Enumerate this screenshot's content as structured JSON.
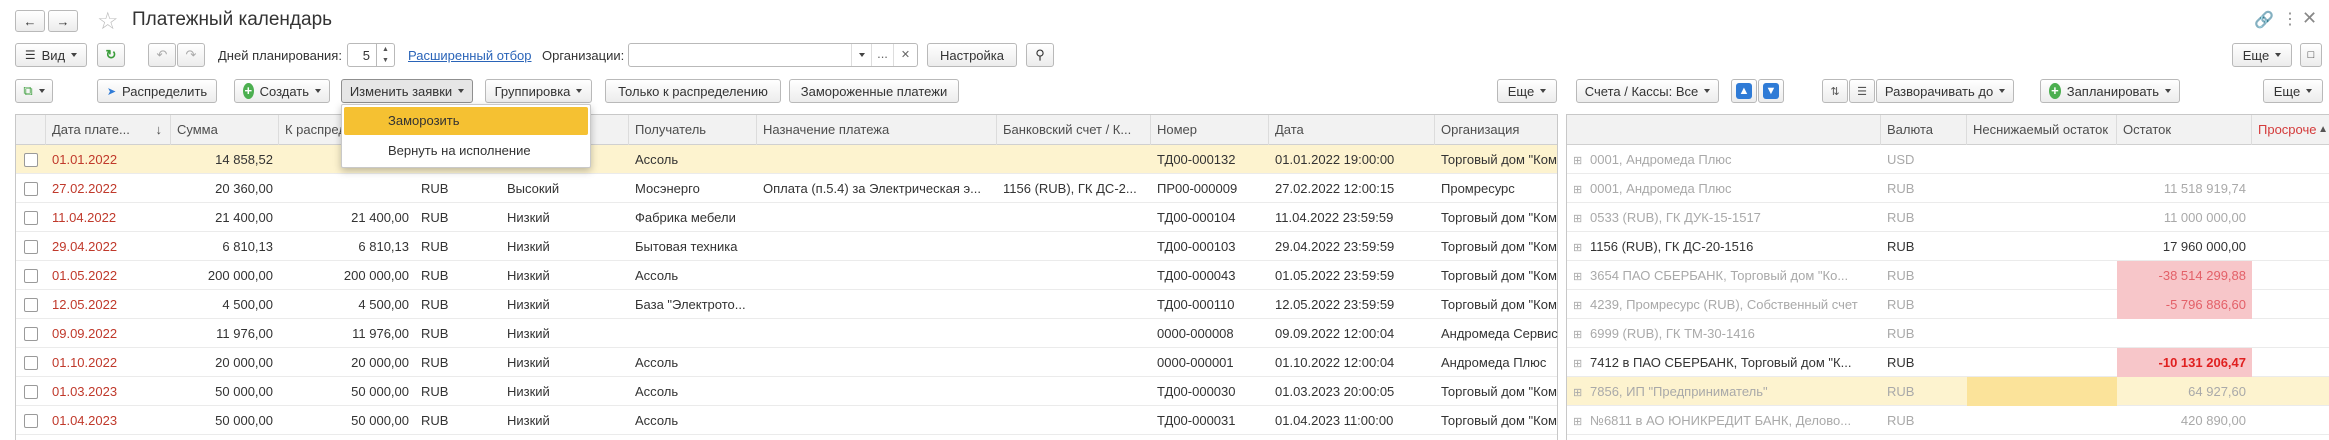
{
  "title": "Платежный календарь",
  "toolbar1": {
    "view": "Вид",
    "days_label": "Дней планирования:",
    "days_value": "5",
    "ext_filter": "Расширенный отбор",
    "orgs_label": "Организации:",
    "orgs_value": "",
    "settings": "Настройка",
    "more": "Еще"
  },
  "toolbar2": {
    "distribute": "Распределить",
    "create": "Создать",
    "change_requests": "Изменить заявки",
    "grouping": "Группировка",
    "only_to_distribute": "Только к распределению",
    "frozen": "Замороженные платежи",
    "more_left": "Еще",
    "accounts": "Счета / Кассы: Все",
    "expand_to": "Разворачивать до",
    "plan": "Запланировать",
    "more_right": "Еще"
  },
  "dropdown": {
    "items": [
      "Заморозить",
      "Вернуть на исполнение"
    ]
  },
  "left_table": {
    "columns": [
      "Дата плате...",
      "Сумма",
      "К распред",
      "",
      "",
      "Получатель",
      "Назначение платежа",
      "Банковский счет / К...",
      "Номер",
      "Дата",
      "Организация"
    ],
    "rows": [
      {
        "date": "01.01.2022",
        "sum": "14 858,52",
        "dist": "",
        "cur": "",
        "prio": "",
        "payee": "Ассоль",
        "purpose": "",
        "account": "",
        "num": "ТД00-000132",
        "dt": "01.01.2022 19:00:00",
        "org": "Торговый дом \"Ком"
      },
      {
        "date": "27.02.2022",
        "sum": "20 360,00",
        "dist": "",
        "cur": "RUB",
        "prio": "Высокий",
        "payee": "Мосэнерго",
        "purpose": "Оплата (п.5.4) за Электрическая э...",
        "account": "1156 (RUB), ГК ДС-2...",
        "num": "ПР00-000009",
        "dt": "27.02.2022 12:00:15",
        "org": "Промресурс"
      },
      {
        "date": "11.04.2022",
        "sum": "21 400,00",
        "dist": "21 400,00",
        "cur": "RUB",
        "prio": "Низкий",
        "payee": "Фабрика мебели",
        "purpose": "",
        "account": "",
        "num": "ТД00-000104",
        "dt": "11.04.2022 23:59:59",
        "org": "Торговый дом \"Ком"
      },
      {
        "date": "29.04.2022",
        "sum": "6 810,13",
        "dist": "6 810,13",
        "cur": "RUB",
        "prio": "Низкий",
        "payee": "Бытовая техника",
        "purpose": "",
        "account": "",
        "num": "ТД00-000103",
        "dt": "29.04.2022 23:59:59",
        "org": "Торговый дом \"Ком"
      },
      {
        "date": "01.05.2022",
        "sum": "200 000,00",
        "dist": "200 000,00",
        "cur": "RUB",
        "prio": "Низкий",
        "payee": "Ассоль",
        "purpose": "",
        "account": "",
        "num": "ТД00-000043",
        "dt": "01.05.2022 23:59:59",
        "org": "Торговый дом \"Ком"
      },
      {
        "date": "12.05.2022",
        "sum": "4 500,00",
        "dist": "4 500,00",
        "cur": "RUB",
        "prio": "Низкий",
        "payee": "База \"Электрото...",
        "purpose": "",
        "account": "",
        "num": "ТД00-000110",
        "dt": "12.05.2022 23:59:59",
        "org": "Торговый дом \"Ком"
      },
      {
        "date": "09.09.2022",
        "sum": "11 976,00",
        "dist": "11 976,00",
        "cur": "RUB",
        "prio": "Низкий",
        "payee": "",
        "purpose": "",
        "account": "",
        "num": "0000-000008",
        "dt": "09.09.2022 12:00:04",
        "org": "Андромеда Сервис"
      },
      {
        "date": "01.10.2022",
        "sum": "20 000,00",
        "dist": "20 000,00",
        "cur": "RUB",
        "prio": "Низкий",
        "payee": "Ассоль",
        "purpose": "",
        "account": "",
        "num": "0000-000001",
        "dt": "01.10.2022 12:00:04",
        "org": "Андромеда Плюс"
      },
      {
        "date": "01.03.2023",
        "sum": "50 000,00",
        "dist": "50 000,00",
        "cur": "RUB",
        "prio": "Низкий",
        "payee": "Ассоль",
        "purpose": "",
        "account": "",
        "num": "ТД00-000030",
        "dt": "01.03.2023 20:00:05",
        "org": "Торговый дом \"Ком"
      },
      {
        "date": "01.04.2023",
        "sum": "50 000,00",
        "dist": "50 000,00",
        "cur": "RUB",
        "prio": "Низкий",
        "payee": "Ассоль",
        "purpose": "",
        "account": "",
        "num": "ТД00-000031",
        "dt": "01.04.2023 11:00:00",
        "org": "Торговый дом \"Ком"
      }
    ]
  },
  "right_table": {
    "columns": [
      "",
      "Валюта",
      "Неснижаемый остаток",
      "Остаток",
      "Просроче"
    ],
    "rows": [
      {
        "name": "0001, Андромеда Плюс",
        "cur": "USD",
        "min": "",
        "bal": "",
        "state": "gray"
      },
      {
        "name": "0001, Андромеда Плюс",
        "cur": "RUB",
        "min": "",
        "bal": "11 518 919,74",
        "state": "gray"
      },
      {
        "name": "0533 (RUB), ГК ДУК-15-1517",
        "cur": "RUB",
        "min": "",
        "bal": "11 000 000,00",
        "state": "gray"
      },
      {
        "name": "1156 (RUB), ГК ДС-20-1516",
        "cur": "RUB",
        "min": "",
        "bal": "17 960 000,00",
        "state": "normal"
      },
      {
        "name": "3654 ПАО СБЕРБАНК, Торговый дом \"Ко...",
        "cur": "RUB",
        "min": "",
        "bal": "-38 514 299,88",
        "state": "neg"
      },
      {
        "name": "4239, Промресурс (RUB), Собственный счет",
        "cur": "RUB",
        "min": "",
        "bal": "-5 796 886,60",
        "state": "neg"
      },
      {
        "name": "6999 (RUB), ГК ТМ-30-1416",
        "cur": "RUB",
        "min": "",
        "bal": "",
        "state": "gray"
      },
      {
        "name": "7412 в ПАО СБЕРБАНК, Торговый дом \"К...",
        "cur": "RUB",
        "min": "",
        "bal": "-10 131 206,47",
        "state": "negstrong"
      },
      {
        "name": "7856, ИП \"Предприниматель\"",
        "cur": "RUB",
        "min": "",
        "bal": "64 927,60",
        "state": "selgray"
      },
      {
        "name": "№6811 в АО ЮНИКРЕДИТ БАНК, Делово...",
        "cur": "RUB",
        "min": "",
        "bal": "420 890,00",
        "state": "gray"
      }
    ]
  },
  "colors": {
    "accent_link": "#2a64b8",
    "selected_row": "#fdf3cf",
    "negative_fill": "#f7c6c9",
    "menu_highlight": "#f5c132"
  },
  "icons": [
    "back-arrow-icon",
    "forward-arrow-icon",
    "star-icon",
    "link-icon",
    "kebab-icon",
    "close-icon",
    "refresh-icon",
    "undo-icon",
    "redo-icon",
    "search-icon"
  ]
}
